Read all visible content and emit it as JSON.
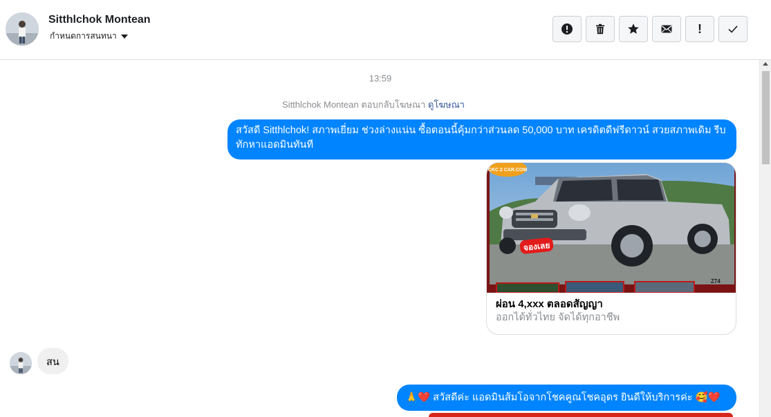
{
  "header": {
    "contact_name": "Sitthlchok Montean",
    "conversation_settings": "กำหนดการสนทนา",
    "toolbar": [
      {
        "icon": "alert-circle-icon",
        "name": "mark-spam-button"
      },
      {
        "icon": "trash-icon",
        "name": "delete-button"
      },
      {
        "icon": "star-icon",
        "name": "star-button"
      },
      {
        "icon": "envelope-icon",
        "name": "mark-unread-button"
      },
      {
        "icon": "exclamation-icon",
        "name": "follow-up-button",
        "glyph": "!"
      },
      {
        "icon": "checkmark-icon",
        "name": "mark-done-button"
      }
    ]
  },
  "thread": {
    "timestamp": "13:59",
    "reply_note": "Sitthlchok Montean ตอบกลับโฆษณา",
    "reply_link": "ดูโฆษณา",
    "message_1": "สวัสดี Sitthlchok!  สภาพเยี่ยม ช่วงล่างแน่น  ซื้อตอนนี้คุ้มกว่าส่วนลด 50,000 บาท เครดิตดีฟรีดาวน์  สวยสภาพเดิม รีบทักหาแอดมินทันที",
    "ad_card": {
      "title": "ผ่อน 4,xxx ตลอดสัญญา",
      "subtitle": "ออกได้ทั่วไทย จัดได้ทุกอาชีพ",
      "image_logo_text": "CKC 2 CAR.COM",
      "image_badge_text": "จองเลย",
      "image_code": "Z74"
    },
    "incoming_message": "สน",
    "message_3": "🙏❤️ สวัสดีค่ะ แอดมินส้มโอจากโชคคูณโชคอุดร ยินดีให้บริการค่ะ 🥰❤️"
  },
  "colors": {
    "accent": "#0084ff",
    "link": "#385898",
    "muted": "#8a8d91",
    "incoming_bubble": "#f0f0f0"
  }
}
